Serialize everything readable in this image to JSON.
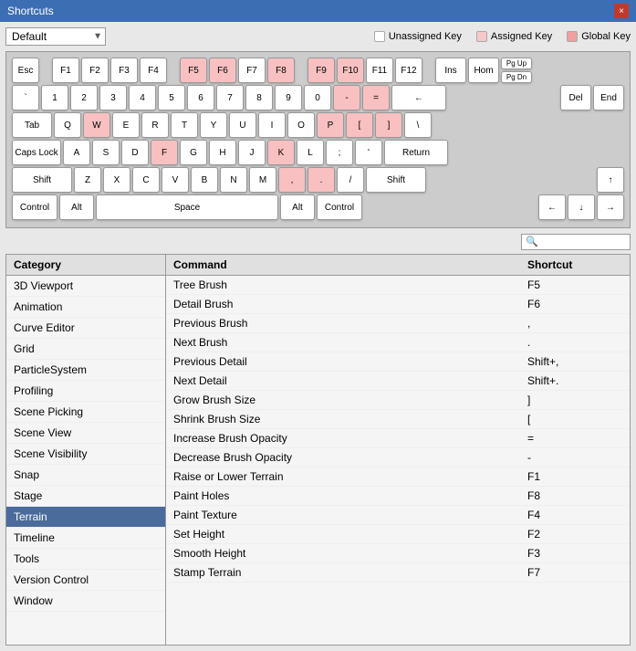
{
  "window": {
    "title": "Shortcuts",
    "close_btn": "×"
  },
  "toolbar": {
    "dropdown_default": "Default",
    "dropdown_arrow": "▼"
  },
  "legend": {
    "unassigned_label": "Unassigned Key",
    "assigned_label": "Assigned Key",
    "global_label": "Global Key"
  },
  "keyboard": {
    "rows": [
      [
        "Esc",
        "",
        "F1",
        "F2",
        "F3",
        "F4",
        "",
        "F5",
        "F6",
        "F7",
        "F8",
        "",
        "F9",
        "F10",
        "F11",
        "F12",
        "",
        "Ins",
        "Hom",
        "PgUp",
        "PgDn"
      ],
      [
        "`",
        "1",
        "2",
        "3",
        "4",
        "5",
        "6",
        "7",
        "8",
        "9",
        "0",
        "-",
        "=",
        "←"
      ],
      [
        "Tab",
        "Q",
        "W",
        "E",
        "R",
        "T",
        "Y",
        "U",
        "I",
        "O",
        "P",
        "[",
        "]",
        "\\"
      ],
      [
        "Caps Lock",
        "A",
        "S",
        "D",
        "F",
        "G",
        "H",
        "J",
        "K",
        "L",
        ";",
        "'",
        "Return"
      ],
      [
        "Shift",
        "Z",
        "X",
        "C",
        "V",
        "B",
        "N",
        "M",
        ",",
        ".",
        "/",
        "Shift"
      ],
      [
        "Control",
        "Alt",
        "Space",
        "Alt",
        "Control"
      ]
    ]
  },
  "search": {
    "placeholder": "🔍"
  },
  "category": {
    "header": "Category",
    "items": [
      {
        "label": "3D Viewport",
        "selected": false
      },
      {
        "label": "Animation",
        "selected": false
      },
      {
        "label": "Curve Editor",
        "selected": false
      },
      {
        "label": "Grid",
        "selected": false
      },
      {
        "label": "ParticleSystem",
        "selected": false
      },
      {
        "label": "Profiling",
        "selected": false
      },
      {
        "label": "Scene Picking",
        "selected": false
      },
      {
        "label": "Scene View",
        "selected": false
      },
      {
        "label": "Scene Visibility",
        "selected": false
      },
      {
        "label": "Snap",
        "selected": false
      },
      {
        "label": "Stage",
        "selected": false
      },
      {
        "label": "Terrain",
        "selected": true
      },
      {
        "label": "Timeline",
        "selected": false
      },
      {
        "label": "Tools",
        "selected": false
      },
      {
        "label": "Version Control",
        "selected": false
      },
      {
        "label": "Window",
        "selected": false
      }
    ]
  },
  "commands": {
    "col_command": "Command",
    "col_shortcut": "Shortcut",
    "rows": [
      {
        "command": "Tree Brush",
        "shortcut": "F5"
      },
      {
        "command": "Detail Brush",
        "shortcut": "F6"
      },
      {
        "command": "Previous Brush",
        "shortcut": ","
      },
      {
        "command": "Next Brush",
        "shortcut": "."
      },
      {
        "command": "Previous Detail",
        "shortcut": "Shift+,"
      },
      {
        "command": "Next Detail",
        "shortcut": "Shift+."
      },
      {
        "command": "Grow Brush Size",
        "shortcut": "]"
      },
      {
        "command": "Shrink Brush Size",
        "shortcut": "["
      },
      {
        "command": "Increase Brush Opacity",
        "shortcut": "="
      },
      {
        "command": "Decrease Brush Opacity",
        "shortcut": "-"
      },
      {
        "command": "Raise or Lower Terrain",
        "shortcut": "F1"
      },
      {
        "command": "Paint Holes",
        "shortcut": "F8"
      },
      {
        "command": "Paint Texture",
        "shortcut": "F4"
      },
      {
        "command": "Set Height",
        "shortcut": "F2"
      },
      {
        "command": "Smooth Height",
        "shortcut": "F3"
      },
      {
        "command": "Stamp Terrain",
        "shortcut": "F7"
      }
    ]
  }
}
